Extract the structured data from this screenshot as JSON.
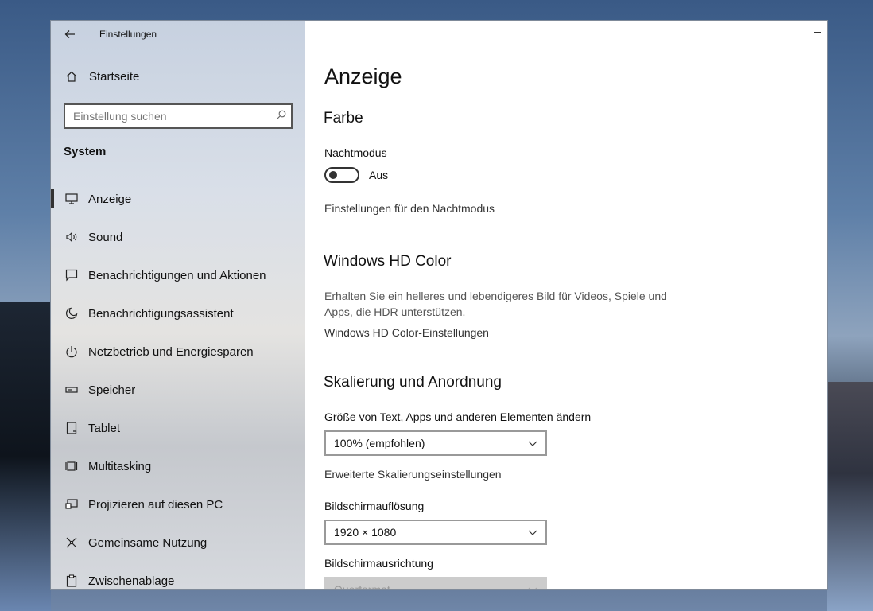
{
  "window": {
    "app_title": "Einstellungen",
    "back_icon": "back-arrow-icon",
    "minimize_icon": "minimize-icon"
  },
  "sidebar": {
    "home_label": "Startseite",
    "search_placeholder": "Einstellung suchen",
    "section_label": "System",
    "items": [
      {
        "label": "Anzeige",
        "icon": "monitor-icon",
        "active": true
      },
      {
        "label": "Sound",
        "icon": "speaker-icon"
      },
      {
        "label": "Benachrichtigungen und Aktionen",
        "icon": "notification-icon"
      },
      {
        "label": "Benachrichtigungsassistent",
        "icon": "moon-icon"
      },
      {
        "label": "Netzbetrieb und Energiesparen",
        "icon": "power-icon"
      },
      {
        "label": "Speicher",
        "icon": "storage-icon"
      },
      {
        "label": "Tablet",
        "icon": "tablet-icon"
      },
      {
        "label": "Multitasking",
        "icon": "multitasking-icon"
      },
      {
        "label": "Projizieren auf diesen PC",
        "icon": "project-icon"
      },
      {
        "label": "Gemeinsame Nutzung",
        "icon": "shared-experiences-icon"
      },
      {
        "label": "Zwischenablage",
        "icon": "clipboard-icon"
      }
    ]
  },
  "main": {
    "title": "Anzeige",
    "color_heading": "Farbe",
    "night_mode_label": "Nachtmodus",
    "night_mode_state": "Aus",
    "night_mode_on": false,
    "night_mode_settings_link": "Einstellungen für den Nachtmodus",
    "hdr_heading": "Windows HD Color",
    "hdr_description": "Erhalten Sie ein helleres und lebendigeres Bild für Videos, Spiele und Apps, die HDR unterstützen.",
    "hdr_settings_link": "Windows HD Color-Einstellungen",
    "scale_heading": "Skalierung und Anordnung",
    "scale_label": "Größe von Text, Apps und anderen Elementen ändern",
    "scale_value": "100% (empfohlen)",
    "advanced_scaling_link": "Erweiterte Skalierungseinstellungen",
    "resolution_label": "Bildschirmauflösung",
    "resolution_value": "1920 × 1080",
    "orientation_label": "Bildschirmausrichtung",
    "orientation_value": "Querformat"
  }
}
